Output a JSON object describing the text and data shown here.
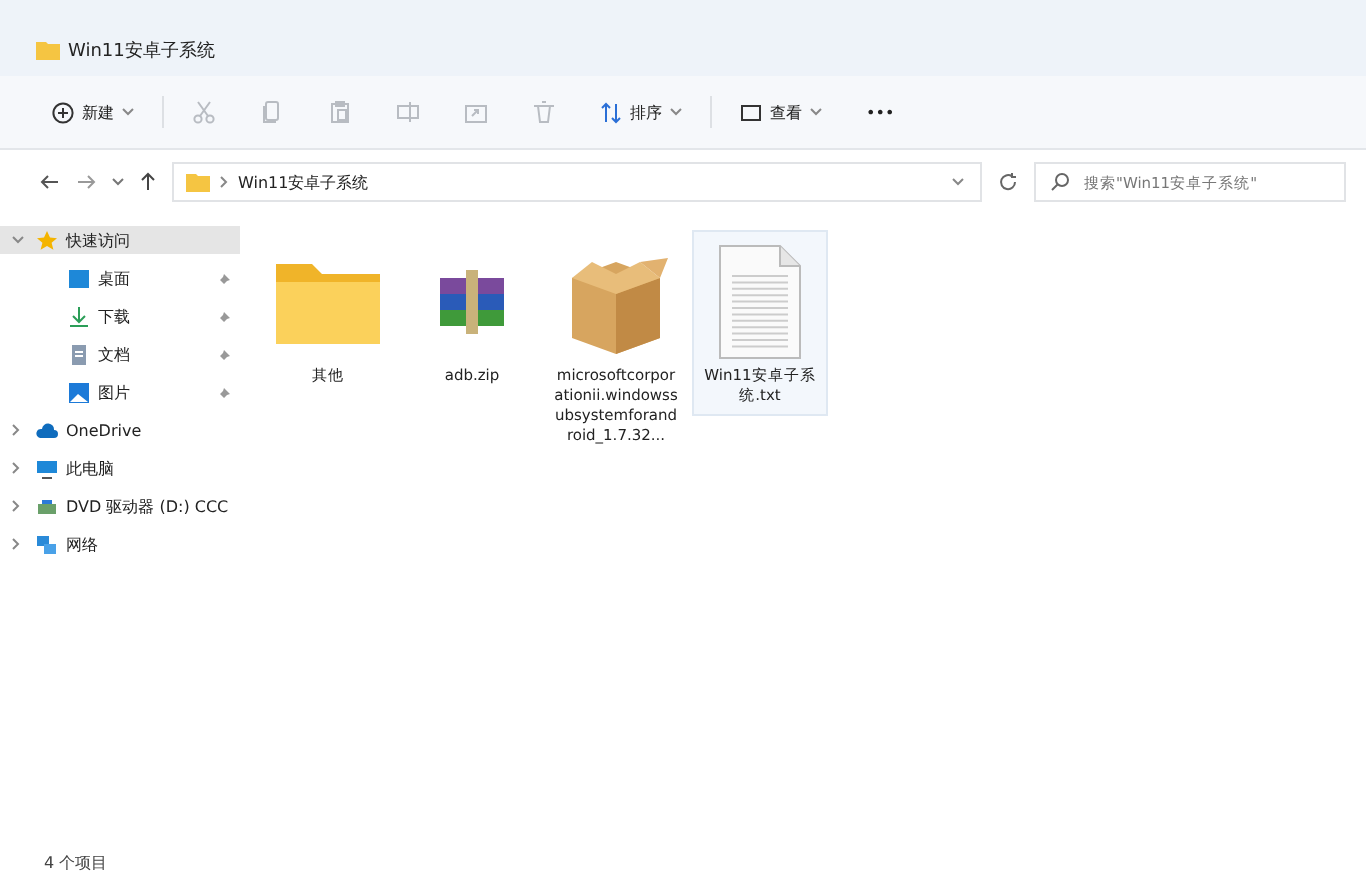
{
  "window": {
    "title": "Win11安卓子系统"
  },
  "toolbar": [
    {
      "kind": "new",
      "label": "新建",
      "disabled": false
    },
    {
      "kind": "cut",
      "disabled": true
    },
    {
      "kind": "copy",
      "disabled": true
    },
    {
      "kind": "paste",
      "disabled": true
    },
    {
      "kind": "rename",
      "disabled": true
    },
    {
      "kind": "share",
      "disabled": true
    },
    {
      "kind": "delete",
      "disabled": true
    },
    {
      "kind": "sort",
      "label": "排序",
      "disabled": false
    },
    {
      "kind": "view",
      "label": "查看",
      "disabled": false
    },
    {
      "kind": "more",
      "label": "•••",
      "disabled": false
    }
  ],
  "address": {
    "path": "Win11安卓子系统",
    "search_placeholder": "搜索\"Win11安卓子系统\""
  },
  "sidebar": {
    "items": [
      {
        "kind": "star",
        "label": "快速访问",
        "expanded": true,
        "selected": true,
        "children": [
          {
            "kind": "desktop",
            "label": "桌面",
            "pinned": true,
            "selected": false
          },
          {
            "kind": "download",
            "label": "下载",
            "pinned": true,
            "selected": false
          },
          {
            "kind": "docs",
            "label": "文档",
            "pinned": true,
            "selected": false
          },
          {
            "kind": "pictures",
            "label": "图片",
            "pinned": true,
            "selected": false
          }
        ]
      },
      {
        "kind": "cloud",
        "label": "OneDrive",
        "expanded": false,
        "selected": false
      },
      {
        "kind": "pc",
        "label": "此电脑",
        "expanded": false,
        "selected": false
      },
      {
        "kind": "dvd",
        "label": "DVD 驱动器 (D:) CCC",
        "expanded": false,
        "selected": false
      },
      {
        "kind": "network",
        "label": "网络",
        "expanded": false,
        "selected": false
      }
    ]
  },
  "files": [
    {
      "kind": "folder",
      "name": "其他",
      "selected": false
    },
    {
      "kind": "zip",
      "name": "adb.zip",
      "selected": false
    },
    {
      "kind": "package",
      "name": "microsoftcorporationii.windowssubsystemforandroid_1.7.32...",
      "selected": false
    },
    {
      "kind": "text",
      "name": "Win11安卓子系统.txt",
      "selected": true
    }
  ],
  "status_bar": {
    "count": "4 个项目"
  }
}
